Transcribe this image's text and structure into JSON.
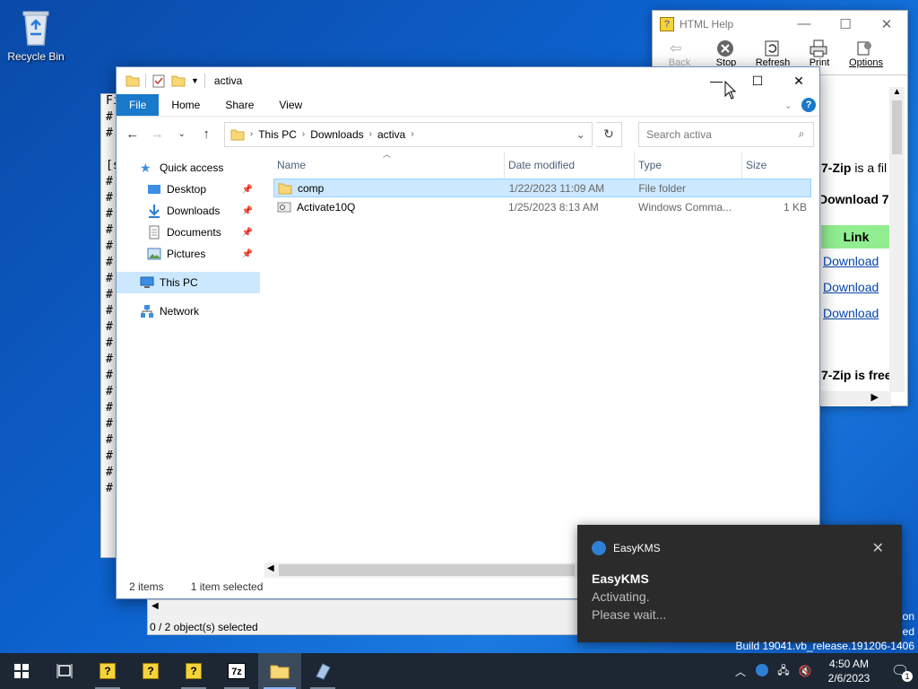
{
  "desktop": {
    "recycle_bin_label": "Recycle Bin"
  },
  "notepad": {
    "lines": [
      "Fi",
      "#",
      "#",
      "",
      "[s",
      "#",
      "#",
      "#",
      "#",
      "#",
      "#",
      "#",
      "#",
      "#",
      "#",
      "#",
      "#",
      "#",
      "#",
      "#",
      "#",
      "#",
      "#",
      "#",
      "#"
    ]
  },
  "html_help": {
    "title": "HTML Help",
    "toolbar": [
      {
        "label": "Back",
        "icon": "back-arrow-icon",
        "enabled": false
      },
      {
        "label": "Stop",
        "icon": "stop-icon",
        "enabled": true
      },
      {
        "label": "Refresh",
        "icon": "refresh-icon",
        "enabled": true
      },
      {
        "label": "Print",
        "icon": "printer-icon",
        "enabled": true
      },
      {
        "label": "Options",
        "icon": "options-icon",
        "enabled": true
      }
    ],
    "content": {
      "line1_bold": "7-Zip",
      "line1_rest": " is a fil",
      "line2": "Download 7",
      "table_header": "Link",
      "links": [
        "Download",
        "Download",
        "Download"
      ],
      "line3_bold": "7-Zip",
      "line3_rest": " is free"
    }
  },
  "explorer": {
    "title": "activa",
    "ribbon_tabs": [
      "File",
      "Home",
      "Share",
      "View"
    ],
    "breadcrumb": [
      "This PC",
      "Downloads",
      "activa"
    ],
    "search_placeholder": "Search activa",
    "nav": {
      "quick_access": "Quick access",
      "items": [
        "Desktop",
        "Downloads",
        "Documents",
        "Pictures"
      ],
      "this_pc": "This PC",
      "network": "Network"
    },
    "columns": [
      "Name",
      "Date modified",
      "Type",
      "Size"
    ],
    "files": [
      {
        "name": "comp",
        "date": "1/22/2023 11:09 AM",
        "type": "File folder",
        "size": "",
        "icon": "folder-icon",
        "selected": true
      },
      {
        "name": "Activate10Q",
        "date": "1/25/2023 8:13 AM",
        "type": "Windows Comma...",
        "size": "1 KB",
        "icon": "batch-file-icon",
        "selected": false
      }
    ],
    "status": {
      "items": "2 items",
      "selected": "1 item selected"
    }
  },
  "bg_7zip": {
    "status": "0 / 2 object(s) selected"
  },
  "toast": {
    "app": "EasyKMS",
    "title": "EasyKMS",
    "line1": "Activating.",
    "line2": "Please wait..."
  },
  "watermark": {
    "line1": "on",
    "line2": "ed",
    "build": "Build 19041.vb_release.191206-1406"
  },
  "taskbar": {
    "time": "4:50 AM",
    "date": "2/6/2023",
    "notification_count": "1"
  },
  "colors": {
    "accent": "#1979ca",
    "selection": "#cce8ff",
    "taskbar": "#1c2733",
    "toast_bg": "#2b2b2b",
    "link": "#0645ad",
    "link_header": "#90ee90"
  }
}
